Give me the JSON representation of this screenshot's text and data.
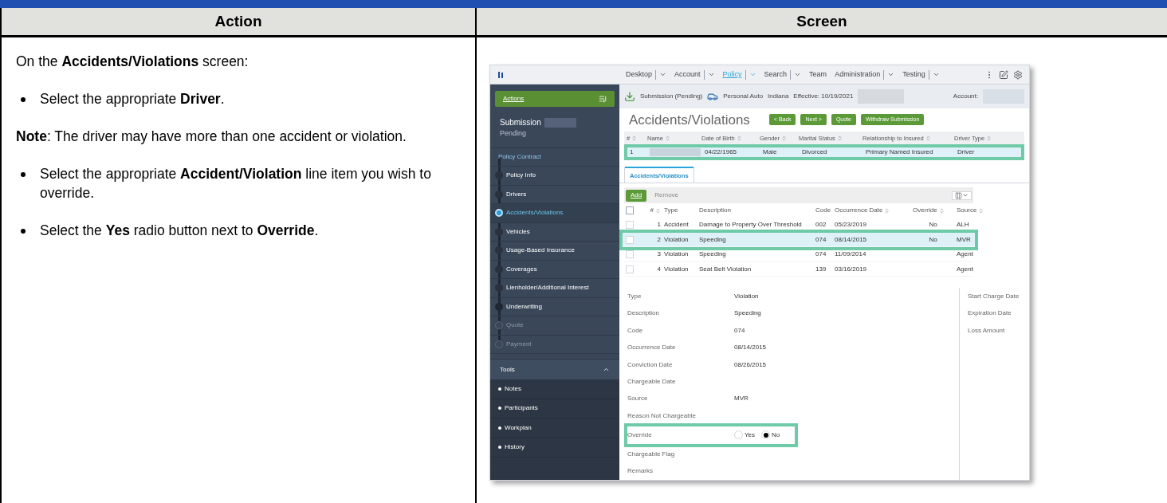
{
  "document": {
    "columns": [
      "Action",
      "Screen"
    ]
  },
  "action": {
    "intro": "On the **Accidents/Violations** screen:",
    "blocks": [
      {
        "kind": "bullet",
        "text": "Select the appropriate **Driver**."
      },
      {
        "kind": "note",
        "text": "**Note**: The driver may have more than one accident or violation."
      },
      {
        "kind": "bullet",
        "text": "Select the appropriate **Accident/Violation** line item you wish to override."
      },
      {
        "kind": "bullet",
        "text": "Select the **Yes** radio button next to **Override**."
      }
    ]
  },
  "screen": {
    "nav": [
      {
        "label": "Desktop",
        "dropdown": true,
        "selected": false
      },
      {
        "label": "Account",
        "dropdown": true,
        "selected": false
      },
      {
        "label": "Policy",
        "dropdown": true,
        "selected": true
      },
      {
        "label": "Search",
        "dropdown": true,
        "selected": false
      },
      {
        "label": "Team",
        "dropdown": false,
        "selected": false
      },
      {
        "label": "Administration",
        "dropdown": true,
        "selected": false
      },
      {
        "label": "Testing",
        "dropdown": true,
        "selected": false
      }
    ],
    "sidebar": {
      "actions": "Actions",
      "job": "Submission",
      "job_status": "Pending",
      "steps": [
        {
          "kind": "header",
          "label": "Policy Contract",
          "selected": false,
          "disabled": false
        },
        {
          "kind": "step",
          "label": "Policy Info",
          "selected": false,
          "disabled": false
        },
        {
          "kind": "step",
          "label": "Drivers",
          "selected": false,
          "disabled": false
        },
        {
          "kind": "step",
          "label": "Accidents/Violations",
          "selected": true,
          "disabled": false
        },
        {
          "kind": "step",
          "label": "Vehicles",
          "selected": false,
          "disabled": false
        },
        {
          "kind": "step",
          "label": "Usage-Based Insurance",
          "selected": false,
          "disabled": false
        },
        {
          "kind": "step",
          "label": "Coverages",
          "selected": false,
          "disabled": false
        },
        {
          "kind": "step",
          "label": "Lienholder/Additional Interest",
          "selected": false,
          "disabled": false
        },
        {
          "kind": "header",
          "label": "Underwriting",
          "selected": false,
          "disabled": false
        },
        {
          "kind": "header",
          "label": "Quote",
          "selected": false,
          "disabled": true
        },
        {
          "kind": "header",
          "label": "Payment",
          "selected": false,
          "disabled": true
        }
      ],
      "tools": {
        "label": "Tools",
        "expanded": true,
        "items": [
          "Notes",
          "Participants",
          "Workplan",
          "History"
        ]
      }
    },
    "info_bar": {
      "status": "Submission (Pending)",
      "product": "Personal Auto",
      "state": "Indiana",
      "effective": "Effective: 10/19/2021",
      "account": "Account:"
    },
    "title": "Accidents/Violations",
    "buttons": [
      "< Back",
      "Next >",
      "Quote",
      "Withdraw Submission"
    ],
    "drivers": {
      "columns": [
        "#",
        "Name",
        "Date of Birth",
        "Gender",
        "Marital Status",
        "Relationship to Insured",
        "Driver Type"
      ],
      "rows": [
        {
          "annotated": true,
          "cells": [
            "1",
            "",
            "04/22/1965",
            "Male",
            "Divorced",
            "Primary Named Insured",
            "Driver"
          ]
        }
      ]
    },
    "tabs": [
      {
        "label": "Accidents/Violations",
        "selected": true
      }
    ],
    "toolbar": {
      "add": "Add",
      "remove": "Remove"
    },
    "incidents": {
      "all_checked": false,
      "columns": [
        "#",
        "Type",
        "Description",
        "Code",
        "Occurrence Date",
        "Override",
        "Source"
      ],
      "rows": [
        {
          "annotated": false,
          "selected": false,
          "checked": false,
          "cells": [
            "1",
            "Accident",
            "Damage to Property Over Threshold",
            "002",
            "05/23/2019",
            "No",
            "ALH"
          ]
        },
        {
          "annotated": true,
          "selected": true,
          "checked": false,
          "cells": [
            "2",
            "Violation",
            "Speeding",
            "074",
            "08/14/2015",
            "No",
            "MVR"
          ]
        },
        {
          "annotated": false,
          "selected": false,
          "checked": false,
          "cells": [
            "3",
            "Violation",
            "Speeding",
            "074",
            "11/09/2014",
            "",
            "Agent"
          ]
        },
        {
          "annotated": false,
          "selected": false,
          "checked": false,
          "cells": [
            "4",
            "Violation",
            "Seat Belt Violation",
            "139",
            "03/16/2019",
            "",
            "Agent"
          ]
        }
      ]
    },
    "details": [
      {
        "kind": "text",
        "label": "Type",
        "value": "Violation",
        "annotated": false
      },
      {
        "kind": "text",
        "label": "Description",
        "value": "Speeding",
        "annotated": false
      },
      {
        "kind": "text",
        "label": "Code",
        "value": "074",
        "annotated": false
      },
      {
        "kind": "text",
        "label": "Occurrence Date",
        "value": "08/14/2015",
        "annotated": false
      },
      {
        "kind": "text",
        "label": "Conviction Date",
        "value": "08/26/2015",
        "annotated": false
      },
      {
        "kind": "text",
        "label": "Chargeable Date",
        "annotated": false
      },
      {
        "kind": "text",
        "label": "Source",
        "value": "MVR",
        "annotated": false
      },
      {
        "kind": "text",
        "label": "Reason Not Chargeable",
        "annotated": false
      },
      {
        "kind": "radio",
        "label": "Override",
        "annotated": true,
        "options": [
          {
            "label": "Yes",
            "selected": false
          },
          {
            "label": "No",
            "selected": true
          }
        ]
      },
      {
        "kind": "text",
        "label": "Chargeable Flag",
        "annotated": false
      },
      {
        "kind": "text",
        "label": "Remarks",
        "annotated": false
      }
    ],
    "details_right": [
      "Start Charge Date",
      "Expiration Date",
      "Loss Amount"
    ]
  }
}
